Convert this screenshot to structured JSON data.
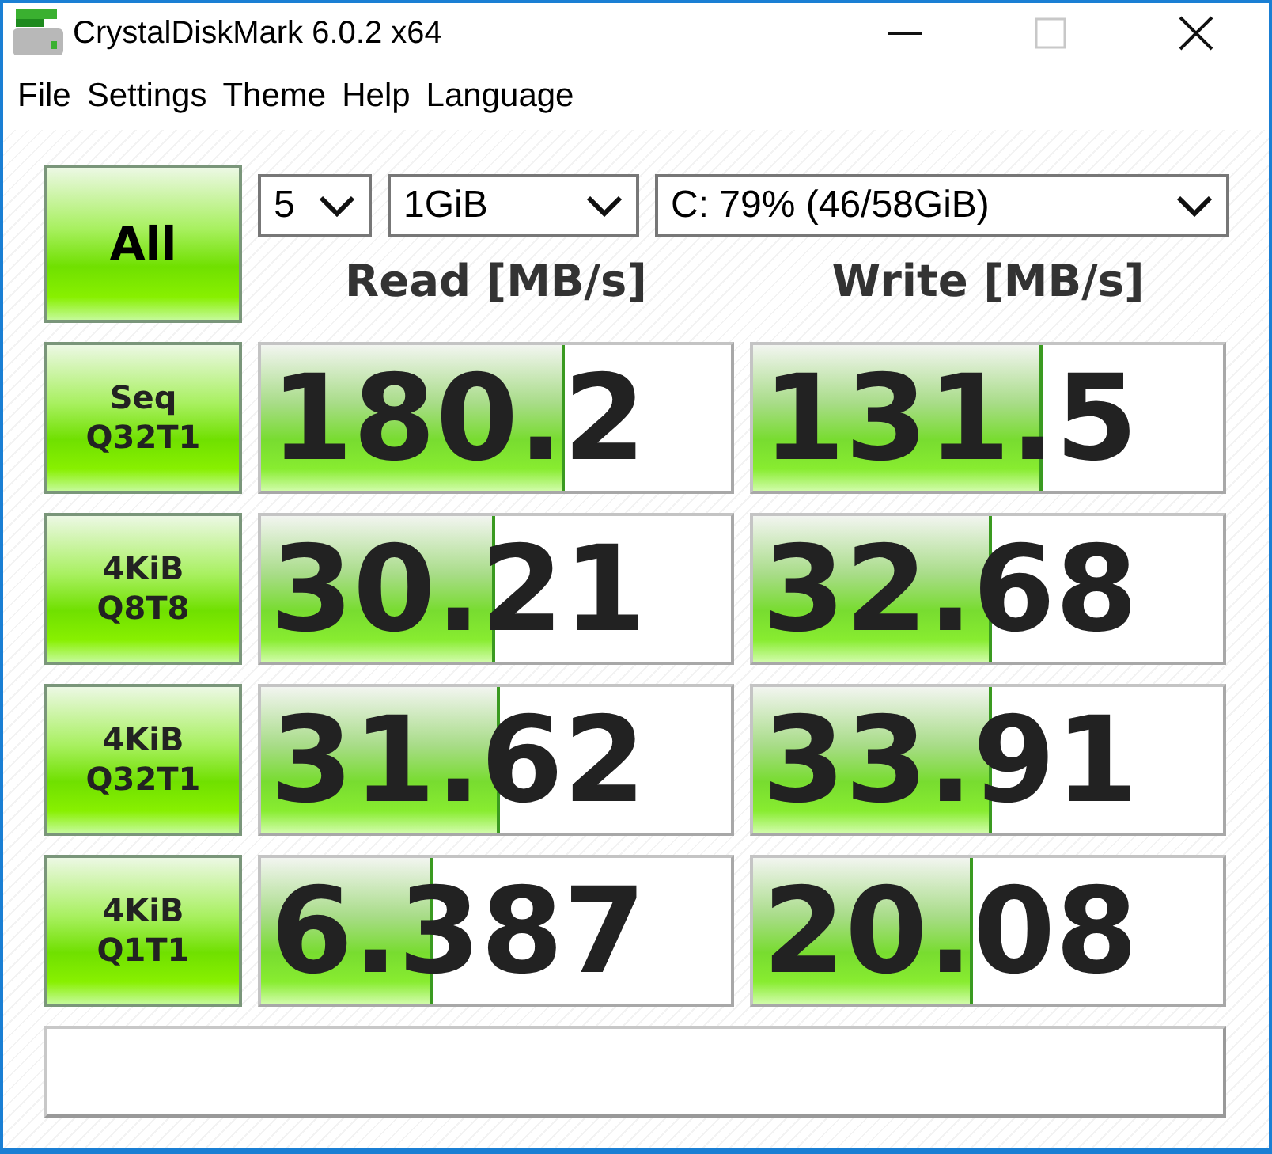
{
  "window": {
    "title": "CrystalDiskMark 6.0.2 x64",
    "controls": [
      {
        "kind": "minimize",
        "disabled": false
      },
      {
        "kind": "maximize",
        "disabled": true
      },
      {
        "kind": "close",
        "disabled": false
      }
    ]
  },
  "menu": [
    "File",
    "Settings",
    "Theme",
    "Help",
    "Language"
  ],
  "all_button": "All",
  "selects": [
    {
      "value": "5"
    },
    {
      "value": "1GiB"
    },
    {
      "value": "C: 79% (46/58GiB)"
    }
  ],
  "headers": [
    "Read [MB/s]",
    "Write [MB/s]"
  ],
  "tests": [
    {
      "label": [
        "Seq",
        "Q32T1"
      ],
      "read": {
        "value": "180.2",
        "level": 0.64
      },
      "write": {
        "value": "131.5",
        "level": 0.61
      }
    },
    {
      "label": [
        "4KiB",
        "Q8T8"
      ],
      "read": {
        "value": "30.21",
        "level": 0.49
      },
      "write": {
        "value": "32.68",
        "level": 0.5
      }
    },
    {
      "label": [
        "4KiB",
        "Q32T1"
      ],
      "read": {
        "value": "31.62",
        "level": 0.5
      },
      "write": {
        "value": "33.91",
        "level": 0.5
      }
    },
    {
      "label": [
        "4KiB",
        "Q1T1"
      ],
      "read": {
        "value": "6.387",
        "level": 0.36
      },
      "write": {
        "value": "20.08",
        "level": 0.46
      }
    }
  ]
}
